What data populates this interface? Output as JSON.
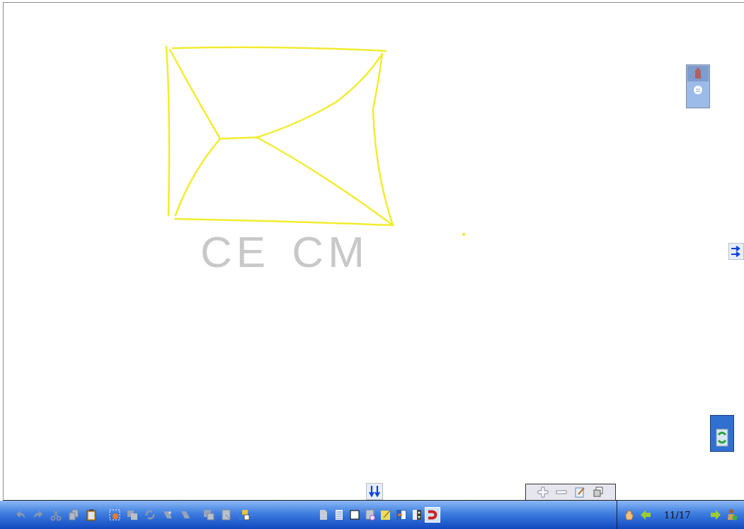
{
  "canvas": {
    "handwritten_text": "CE CM"
  },
  "page_tools": [
    {
      "kind": "blank",
      "selected": false
    },
    {
      "kind": "lined",
      "selected": false
    },
    {
      "kind": "plain",
      "selected": false
    },
    {
      "kind": "capture",
      "selected": false
    },
    {
      "kind": "note",
      "selected": false
    },
    {
      "kind": "import",
      "selected": false
    },
    {
      "kind": "spinner",
      "selected": false
    },
    {
      "kind": "magnet",
      "selected": true
    }
  ],
  "page_counter": "11/17"
}
